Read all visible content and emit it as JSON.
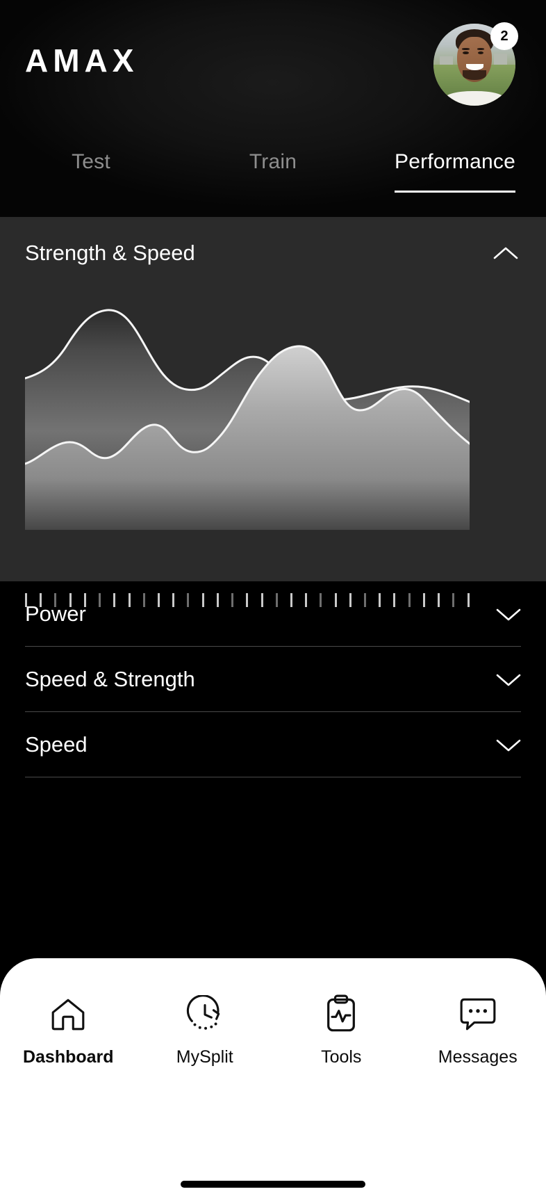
{
  "header": {
    "brand": "AMAX",
    "avatar": {
      "name": "user-avatar",
      "alt": "smiling man outdoors"
    },
    "badge_count": "2"
  },
  "tabs": [
    {
      "label": "Test",
      "active": false
    },
    {
      "label": "Train",
      "active": false
    },
    {
      "label": "Performance",
      "active": true
    }
  ],
  "expanded_card": {
    "title": "Strength & Speed",
    "toggle_icon": "chevron-up-icon",
    "expanded": true
  },
  "accordion_rows": [
    {
      "label": "Power",
      "toggle_icon": "chevron-down-icon",
      "expanded": false
    },
    {
      "label": "Speed & Strength",
      "toggle_icon": "chevron-down-icon",
      "expanded": false
    },
    {
      "label": "Speed",
      "toggle_icon": "chevron-down-icon",
      "expanded": false
    }
  ],
  "bottom_nav": [
    {
      "label": "Dashboard",
      "icon": "home-icon",
      "active": true
    },
    {
      "label": "MySplit",
      "icon": "clock-history-icon",
      "active": false
    },
    {
      "label": "Tools",
      "icon": "clipboard-pulse-icon",
      "active": false
    },
    {
      "label": "Messages",
      "icon": "chat-dots-icon",
      "active": false
    }
  ],
  "colors": {
    "page_background": "#000000",
    "card_background": "#2b2b2b",
    "accent_line": "#ffffff",
    "tab_inactive": "#8e8e8e",
    "divider": "#4a4a4a",
    "nav_background": "#ffffff",
    "series_strength": "#ffffff",
    "series_speed": "#ffffff"
  },
  "chart_data": {
    "type": "area",
    "title": "Strength & Speed",
    "xlabel": "",
    "ylabel": "",
    "grid": false,
    "legend": "none",
    "axis_ticks_count": 31,
    "x": [
      0,
      5,
      10,
      15,
      20,
      25,
      30,
      35,
      40,
      45,
      50,
      55,
      60,
      65,
      70,
      75,
      80,
      85,
      90,
      95,
      100
    ],
    "ylim": [
      0,
      100
    ],
    "series": [
      {
        "name": "Strength",
        "fill": "gradient-dark",
        "stroke": "#ffffff",
        "values": [
          52,
          58,
          72,
          86,
          88,
          78,
          64,
          55,
          50,
          49,
          53,
          60,
          62,
          57,
          48,
          44,
          45,
          47,
          45,
          40,
          37
        ]
      },
      {
        "name": "Speed",
        "fill": "gradient-light",
        "stroke": "#ffffff",
        "values": [
          21,
          27,
          32,
          29,
          26,
          33,
          41,
          40,
          34,
          33,
          40,
          56,
          72,
          80,
          72,
          62,
          60,
          64,
          62,
          52,
          42
        ]
      }
    ]
  }
}
